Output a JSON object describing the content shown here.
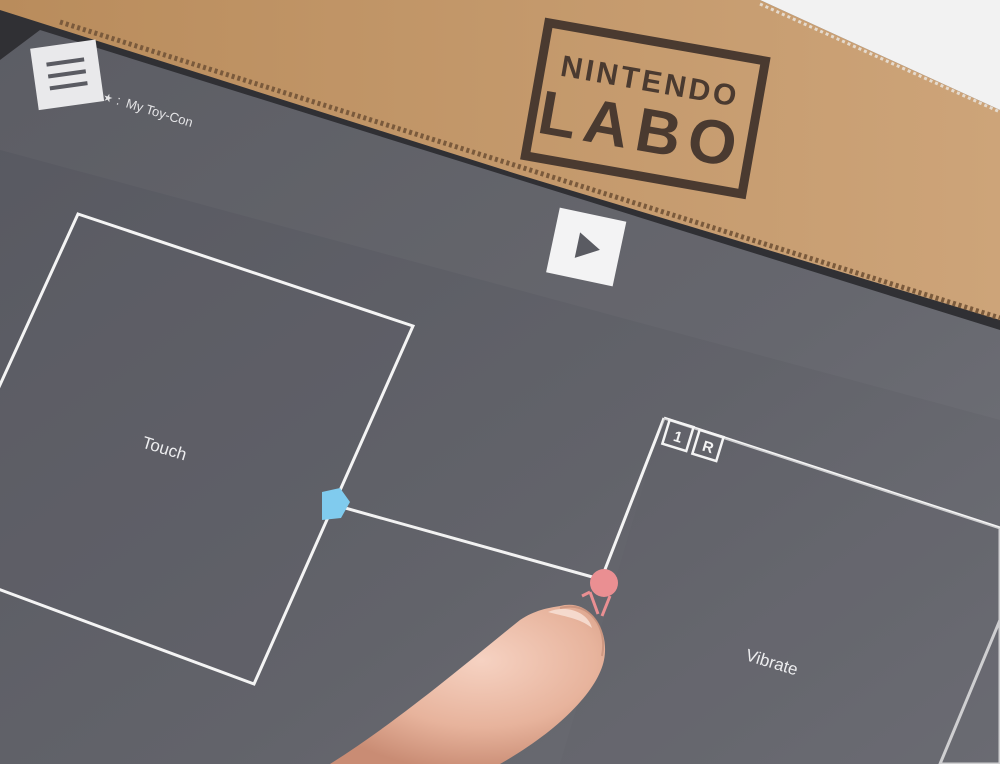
{
  "colors": {
    "cardboard": "#c49a6c",
    "cardboard_dark": "#a97e52",
    "screen": "#5a5b62",
    "screen_light": "#6b6c73",
    "node_outline": "#f4f4f4",
    "touch_port": "#7cc8ea",
    "vibrate_port": "#e88d8d",
    "logo_ink": "#4a3a30",
    "skin": "#e8b7a0"
  },
  "brand": {
    "line1": "NINTENDO",
    "line2": "LABO"
  },
  "header": {
    "menu_icon": "hamburger-menu-icon",
    "breadcrumb_icon": "star-icon",
    "breadcrumb_text": "My Toy-Con"
  },
  "toolbar": {
    "play_icon": "play-icon"
  },
  "nodes": {
    "touch": {
      "label": "Touch"
    },
    "vibrate": {
      "label": "Vibrate",
      "badge_1": "1",
      "badge_2": "R"
    }
  }
}
